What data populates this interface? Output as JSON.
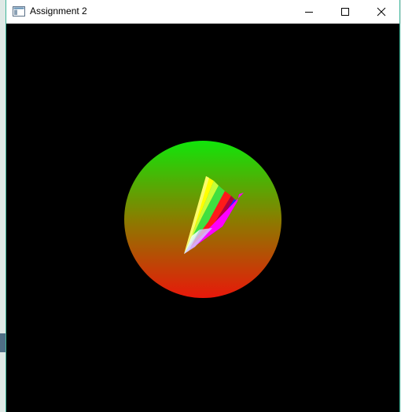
{
  "window": {
    "title": "Assignment 2",
    "icon": "window-app-icon",
    "controls": [
      {
        "name": "minimize-button",
        "icon": "minimize-icon"
      },
      {
        "name": "maximize-button",
        "icon": "maximize-icon"
      },
      {
        "name": "close-button",
        "icon": "close-icon"
      }
    ]
  },
  "scene": {
    "background": "#000000",
    "circle": {
      "gradient_top": "#11e50a",
      "gradient_mid": "#8a7d00",
      "gradient_bottom": "#e8180a"
    },
    "wedge_colors": [
      "#ffffff",
      "#ffff00",
      "#00ff00",
      "#ff0000",
      "#0000ff",
      "#ff00ff"
    ]
  }
}
